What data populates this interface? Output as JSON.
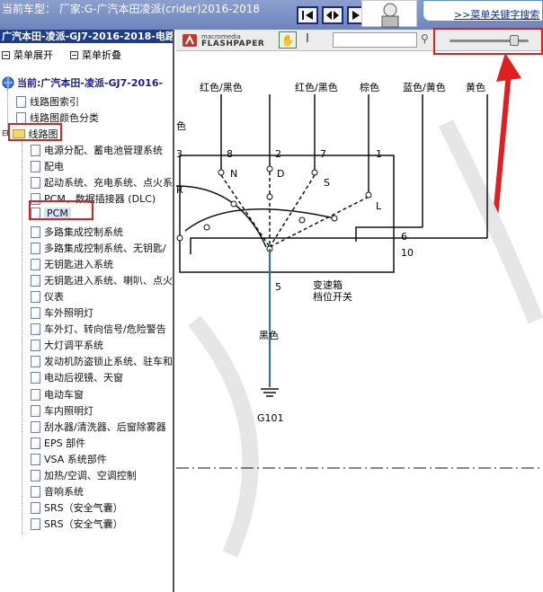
{
  "header": {
    "vehicle_label": "当前车型： 厂家:G-广汽本田凌派(crider)2016-2018",
    "nav_buttons": [
      "first-page",
      "previous-page",
      "next-page"
    ],
    "banner_link": ">>菜单关键字搜索"
  },
  "tree": {
    "title": "广汽本田-凌派-GJ7-2016-2018-电路",
    "expand_label": "菜单展开",
    "collapse_label": "菜单折叠",
    "current_label": "当前:广汽本田-凌派-GJ7-2016-",
    "top_items": [
      "线路图索引",
      "线路图颜色分类"
    ],
    "folder_label": "线路图",
    "items": [
      "电源分配、蓄电池管理系统",
      "配电",
      "起动系统、充电系统、点火系",
      "PCM、数据插接器 (DLC)",
      "PCM",
      "多路集成控制系统",
      "多路集成控制系统、无钥匙/",
      "无钥匙进入系统",
      "无钥匙进入系统、喇叭、点火",
      "仪表",
      "车外照明灯",
      "车外灯、转向信号/危险警告",
      "大灯调平系统",
      "发动机防盗锁止系统、驻车和",
      "电动后视镜、天窗",
      "电动车窗",
      "车内照明灯",
      "刮水器/清洗器、后窗除雾器",
      "EPS 部件",
      "VSA 系统部件",
      "加热/空调、空调控制",
      "音响系统",
      "SRS（安全气囊）",
      "SRS（安全气囊）"
    ]
  },
  "viewer": {
    "logo_small": "macromedia",
    "logo_big": "FLASHPAPER",
    "zoom_level": 0.82
  },
  "diagram": {
    "wire_colors": [
      "红色/黑色",
      "红色/黑色",
      "棕色",
      "蓝色/黄色",
      "黄色"
    ],
    "edge_label": "色",
    "pin_numbers": [
      "3",
      "8",
      "2",
      "7",
      "1"
    ],
    "contact_letters": [
      "N",
      "D",
      "S",
      "L",
      "R"
    ],
    "side_pins": [
      "6",
      "10"
    ],
    "ground_pin": "5",
    "component_name": "变速箱",
    "component_sub": "档位开关",
    "ground_wire_color": "黑色",
    "ground_label": "G101"
  },
  "colors": {
    "header_bg": "#7b8fc4",
    "tree_title_bg": "#1d3d8c",
    "ground_wire": "#2b6cc4",
    "annotation": "#e02020"
  }
}
